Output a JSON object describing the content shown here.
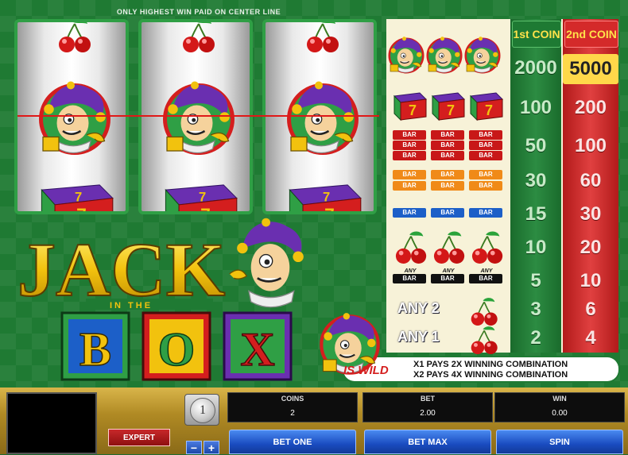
{
  "top_note": "ONLY HIGHEST WIN PAID ON CENTER LINE",
  "paytable": {
    "headers": [
      "1st COIN",
      "2nd COIN"
    ],
    "rows": [
      {
        "symbol": "three-jesters",
        "c1": "2000",
        "c2": "5000"
      },
      {
        "symbol": "three-box-7",
        "c1": "100",
        "c2": "200"
      },
      {
        "symbol": "three-triple-bar",
        "c1": "50",
        "c2": "100"
      },
      {
        "symbol": "three-double-bar",
        "c1": "30",
        "c2": "60"
      },
      {
        "symbol": "three-single-bar",
        "c1": "15",
        "c2": "30"
      },
      {
        "symbol": "three-cherries",
        "c1": "10",
        "c2": "20"
      },
      {
        "symbol": "three-any-bar",
        "c1": "5",
        "c2": "10"
      },
      {
        "symbol": "any-2-cherries",
        "c1": "3",
        "c2": "6"
      },
      {
        "symbol": "any-1-cherry",
        "c1": "2",
        "c2": "4"
      }
    ],
    "bar_label": "BAR",
    "any_label": "ANY",
    "any2_label": "ANY 2",
    "any1_label": "ANY 1"
  },
  "wild": {
    "label": "IS WILD",
    "line1": "X1 PAYS 2X WINNING COMBINATION",
    "line2": "X2 PAYS 4X WINNING COMBINATION"
  },
  "logo": {
    "word1": "JACK",
    "word2": "IN THE",
    "letters": [
      "B",
      "O",
      "X"
    ]
  },
  "controls": {
    "coin_value": "1",
    "expert_label": "EXPERT",
    "minus": "−",
    "plus": "+",
    "coins_label": "COINS",
    "coins_value": "2",
    "bet_label": "BET",
    "bet_value": "2.00",
    "win_label": "WIN",
    "win_value": "0.00",
    "bet_one_label": "BET ONE",
    "bet_max_label": "BET MAX",
    "spin_label": "SPIN"
  },
  "colors": {
    "felt": "#1f7a33",
    "coin1": "#1e7a33",
    "coin2": "#d42a2a",
    "button_blue": "#1a4cc0",
    "gold": "#d9b54a"
  }
}
